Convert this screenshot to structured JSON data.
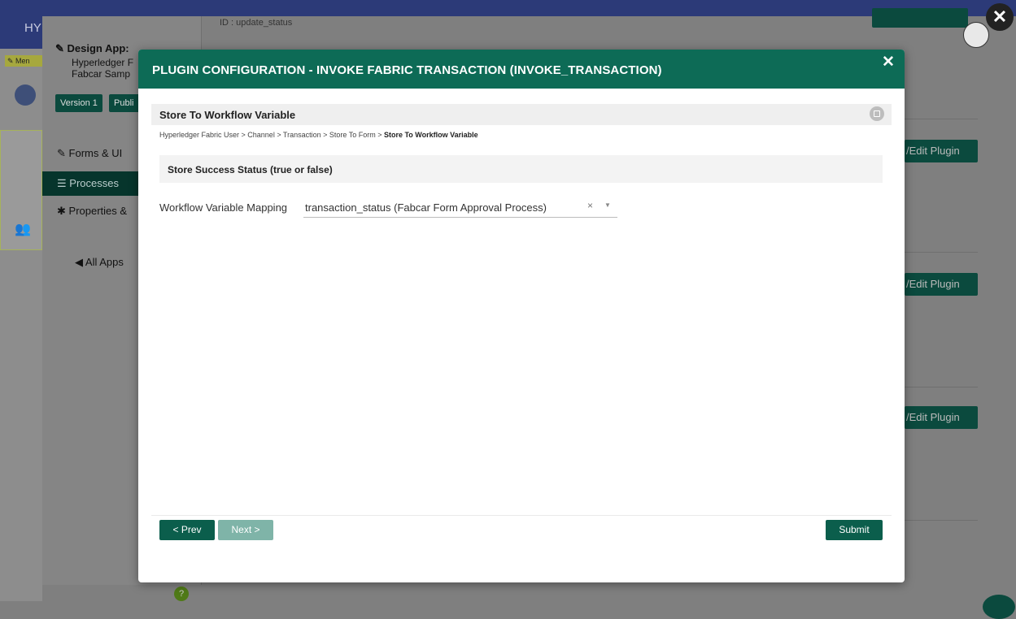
{
  "background": {
    "brand": "HYI",
    "menu_tag": "Men",
    "design_app_title": "Design App:",
    "design_app_line1": "Hyperledger F",
    "design_app_line2": "Fabcar Samp",
    "version_label": "Version 1",
    "publish_label": "Publi",
    "nav": {
      "forms": "Forms & UI",
      "processes": "Processes",
      "properties": "Properties &"
    },
    "all_apps": "All Apps",
    "id_text": "ID : update_status",
    "edit_plugin_label": "/Edit Plugin"
  },
  "modal": {
    "title": "PLUGIN CONFIGURATION - INVOKE FABRIC TRANSACTION (INVOKE_TRANSACTION)",
    "close_glyph": "✕",
    "section_title": "Store To Workflow Variable",
    "breadcrumb_path": "Hyperledger Fabric User > Channel > Transaction > Store To Form > ",
    "breadcrumb_current": "Store To Workflow Variable",
    "subsection_title": "Store Success Status (true or false)",
    "field_label": "Workflow Variable Mapping",
    "field_value": "transaction_status (Fabcar Form Approval Process)",
    "clear_glyph": "×",
    "arrow_glyph": "▼",
    "prev_label": "< Prev",
    "next_label": "Next >",
    "submit_label": "Submit"
  },
  "colors": {
    "modal_header": "#0d6b56",
    "primary_button": "#0b5e4c",
    "disabled_button": "#7fb4a8",
    "topbar": "#2c3a78"
  }
}
